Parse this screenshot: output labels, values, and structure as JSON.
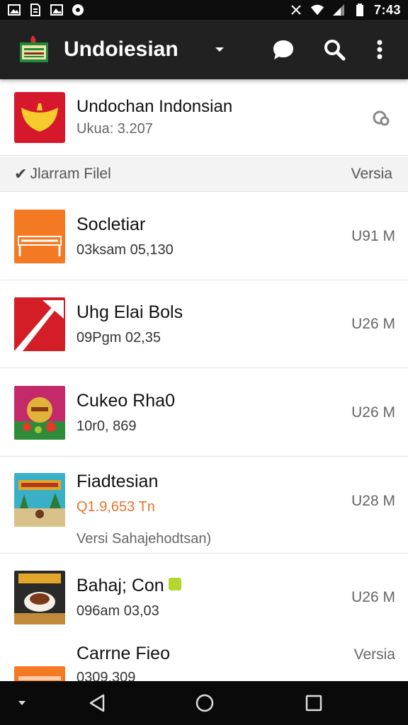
{
  "status_bar": {
    "time": "7:43"
  },
  "app_bar": {
    "title": "Undoiesian"
  },
  "featured": {
    "title": "Undochan Indonsian",
    "subtitle": "Ukua: 3.207"
  },
  "list_header": {
    "left": "Jlarram Filel",
    "right": "Versia"
  },
  "items": [
    {
      "title": "Socletiar",
      "subtitle": "03ksam 05,130",
      "size": "U91 M"
    },
    {
      "title": "Uhg Elai Bols",
      "subtitle": "09Pgm 02,35",
      "size": "U26 M"
    },
    {
      "title": "Cukeo Rha0",
      "subtitle": "10r0, 869",
      "size": "U26 M"
    },
    {
      "title": "Fiadtesian",
      "subtitle": "Q1.9,653 Tn",
      "note": "Versi Sahajehodtsan)",
      "size": "U28 M"
    },
    {
      "title": "Bahaj; Con",
      "subtitle": "096am 03,03",
      "size": "U26 M"
    },
    {
      "title": "Carrne Fieo",
      "subtitle": "0309.309",
      "size": "Versia"
    }
  ],
  "colors": {
    "accent_orange": "#e8742a",
    "appbar_bg": "#212121",
    "status_bg": "#0d0d0d"
  }
}
